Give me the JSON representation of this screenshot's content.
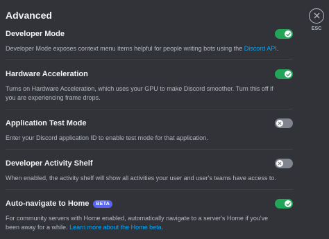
{
  "page": {
    "title": "Advanced"
  },
  "close": {
    "esc_label": "ESC"
  },
  "settings": [
    {
      "label": "Developer Mode",
      "badge": "",
      "enabled": true,
      "desc_prefix": "Developer Mode exposes context menu items helpful for people writing bots using the ",
      "link": "Discord API",
      "desc_suffix": "."
    },
    {
      "label": "Hardware Acceleration",
      "badge": "",
      "enabled": true,
      "desc_prefix": "Turns on Hardware Acceleration, which uses your GPU to make Discord smoother. Turn this off if you are experiencing frame drops.",
      "link": "",
      "desc_suffix": ""
    },
    {
      "label": "Application Test Mode",
      "badge": "",
      "enabled": false,
      "desc_prefix": "Enter your Discord application ID to enable test mode for that application.",
      "link": "",
      "desc_suffix": ""
    },
    {
      "label": "Developer Activity Shelf",
      "badge": "",
      "enabled": false,
      "desc_prefix": "When enabled, the activity shelf will show all activities your user and user's teams have access to.",
      "link": "",
      "desc_suffix": ""
    },
    {
      "label": "Auto-navigate to Home",
      "badge": "BETA",
      "enabled": true,
      "desc_prefix": "For community servers with Home enabled, automatically navigate to a server's Home if you've been away for a while. ",
      "link": "Learn more about the Home beta",
      "desc_suffix": "."
    }
  ],
  "colors": {
    "background": "#313338",
    "toggle_on": "#23a559",
    "toggle_off": "#80848e",
    "link": "#00a8fc",
    "badge": "#5865f2"
  },
  "icons": {
    "close": "close-icon",
    "check": "check-icon",
    "x": "x-icon"
  }
}
